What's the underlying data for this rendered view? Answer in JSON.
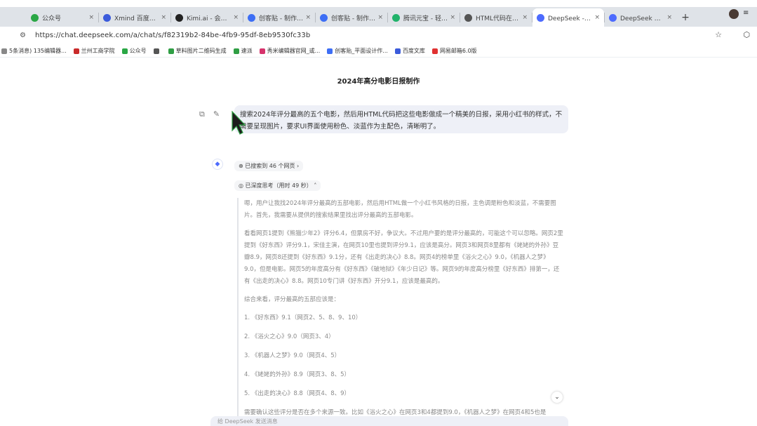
{
  "tabs": [
    {
      "label": "公众号",
      "color": "#2aa745"
    },
    {
      "label": "Xmind 百度搜索",
      "color": "#3b5bdb"
    },
    {
      "label": "Kimi.ai - 会帮你解答",
      "color": "#222222"
    },
    {
      "label": "创客贴 - 制作 - 设计",
      "color": "#3d6ef5"
    },
    {
      "label": "创客贴 - 制作 - 设计",
      "color": "#3d6ef5"
    },
    {
      "label": "腾讯元宝 - 轻松工作",
      "color": "#21b36b"
    },
    {
      "label": "HTML代码在线美化",
      "color": "#555555"
    },
    {
      "label": "DeepSeek - 探索",
      "color": "#4d6bfe",
      "active": true
    },
    {
      "label": "DeepSeek 开放平台",
      "color": "#4d6bfe"
    }
  ],
  "new_tab": "+",
  "address": {
    "url": "https://chat.deepseek.com/a/chat/s/f82319b2-84be-4fb9-95df-8eb9530fc33b"
  },
  "bookmarks": [
    {
      "label": "5条消息) 135编辑器...",
      "color": "#888888"
    },
    {
      "label": "兰州工商学院",
      "color": "#c92a2a"
    },
    {
      "label": "公众号",
      "color": "#2aa745"
    },
    {
      "label": "",
      "color": "#555555"
    },
    {
      "label": "草料图片二维码生成",
      "color": "#2f9e44"
    },
    {
      "label": "速派",
      "color": "#2f9e44"
    },
    {
      "label": "秀米编辑器官网_或...",
      "color": "#d6336c"
    },
    {
      "label": "创客贴_平面设计作...",
      "color": "#3d6ef5"
    },
    {
      "label": "百度文库",
      "color": "#3b5bdb"
    },
    {
      "label": "网易邮箱6.0版",
      "color": "#e03131"
    }
  ],
  "page_title": "2024年高分电影日报制作",
  "user_message": "搜索2024年评分最高的五个电影，然后用HTML代码把这些电影做成一个精美的日报，采用小红书的样式，不需要呈现图片，要求UI界面使用粉色、淡蓝作为主配色，清晰明了。",
  "search_chip": "已搜索到 46 个网页",
  "think_chip": "已深度思考（用时 49 秒）",
  "think_paragraphs": [
    "嗯，用户让我找2024年评分最高的五部电影，然后用HTML做一个小红书风格的日报，主色调是粉色和淡蓝，不需要图片。首先，我需要从提供的搜索结果里找出评分最高的五部电影。",
    "看看网页1提到《熊猫少年2》评分6.4，但票房不好，争议大。不过用户要的是评分最高的，可能这个可以忽略。网页2里提到《好东西》评分9.1，宋佳主演，在网页10里也提到评分9.1，应该是高分。网页3和网页8里都有《姥姥的外孙》豆瓣8.9，网页8还提到《好东西》9.1分，还有《出走的决心》8.8。网页4的榜单里《浴火之心》9.0，《机器人之梦》9.0，但是电影。网页5的年度高分有《好东西》《破地狱》《年少日记》等。网页9的年度高分榜里《好东西》排第一，还有《出走的决心》8.8。网页10专门讲《好东西》开分9.1，应该是最高的。",
    "综合来看，评分最高的五部应该是："
  ],
  "think_list": [
    "1. 《好东西》9.1（网页2、5、8、9、10）",
    "2. 《浴火之心》9.0（网页3、4）",
    "3. 《机器人之梦》9.0（网页4、5）",
    "4. 《姥姥的外孙》8.9（网页3、8、5）",
    "5. 《出走的决心》8.8（网页4、8、9）"
  ],
  "think_tail": "需要确认这些评分是否在多个来源一致。比如《浴火之心》在网页3和4都提到9.0，《机器人之梦》在网页4和5也是",
  "input_hint": "给 DeepSeek 发送消息"
}
